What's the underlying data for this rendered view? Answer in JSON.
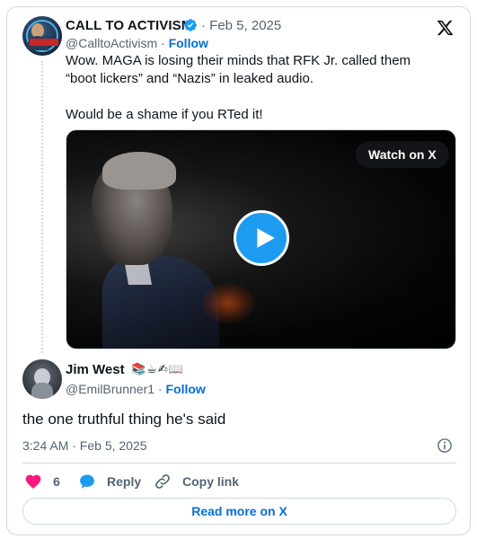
{
  "quoted_tweet": {
    "display_name": "CALL TO ACTIVISM",
    "date": "· Feb 5, 2025",
    "handle": "@CalltoActivism",
    "separator": " · ",
    "follow_label": "Follow",
    "text_line_1": "Wow. MAGA is losing their minds that RFK Jr. called them “boot lickers” and “Nazis” in leaked audio.",
    "text_line_2": "Would be a shame if you RTed it!",
    "video": {
      "watch_label": "Watch on X"
    }
  },
  "reply_tweet": {
    "display_name": "Jim West",
    "name_emoji": "📚☕✍📖",
    "handle": "@EmilBrunner1",
    "separator": " · ",
    "follow_label": "Follow",
    "text": "the one truthful thing he's said",
    "timestamp": "3:24 AM · Feb 5, 2025"
  },
  "actions": {
    "like_count": "6",
    "reply_label": "Reply",
    "copy_label": "Copy link"
  },
  "read_more_label": "Read more on X",
  "icons": {
    "verified": "verified-badge-icon",
    "x_logo": "x-logo-icon",
    "play": "play-icon",
    "info": "info-icon",
    "heart": "heart-icon",
    "reply": "reply-bubble-icon",
    "link": "link-icon"
  },
  "colors": {
    "link_blue": "#006fd6",
    "play_blue": "#1d9bf0",
    "heart_red": "#f91880",
    "muted": "#536471",
    "border": "#cfd9de"
  }
}
